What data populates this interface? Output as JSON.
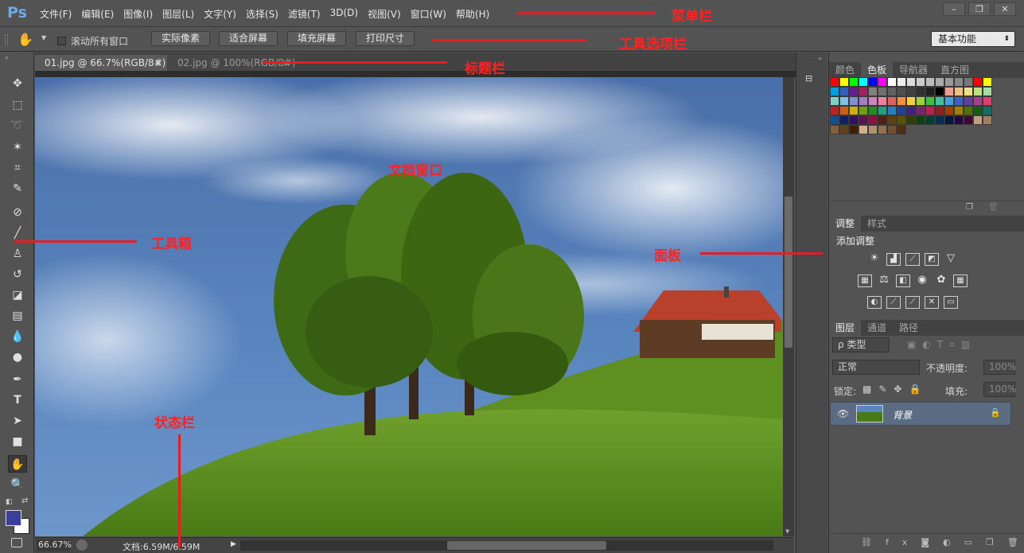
{
  "app": {
    "logo": "Ps"
  },
  "menu": [
    "文件(F)",
    "编辑(E)",
    "图像(I)",
    "图层(L)",
    "文字(Y)",
    "选择(S)",
    "滤镜(T)",
    "3D(D)",
    "视图(V)",
    "窗口(W)",
    "帮助(H)"
  ],
  "window_controls": [
    "–",
    "❐",
    "✕"
  ],
  "options": {
    "scroll_all_label": "滚动所有窗口",
    "buttons": [
      "实际像素",
      "适合屏幕",
      "填充屏幕",
      "打印尺寸"
    ],
    "workspace": "基本功能"
  },
  "tabs": [
    {
      "label": "01.jpg @ 66.7%(RGB/8#)",
      "close": "×"
    },
    {
      "label": "02.jpg @ 100%(RGB/8#)",
      "close": "×"
    }
  ],
  "status": {
    "zoom": "66.67%",
    "doc_info": "文档:6.59M/6.59M"
  },
  "panels": {
    "color_tabs": [
      "颜色",
      "色板",
      "导航器",
      "直方图"
    ],
    "adjust_tabs": [
      "调整",
      "样式"
    ],
    "adjust_title": "添加调整",
    "layer_tabs": [
      "图层",
      "通道",
      "路径"
    ],
    "kind_filter": "ρ 类型",
    "blend_mode": "正常",
    "opacity_label": "不透明度:",
    "opacity_value": "100%",
    "lock_label": "锁定:",
    "fill_label": "填充:",
    "fill_value": "100%",
    "layer_name": "背景"
  },
  "annotations": {
    "menu": "菜单栏",
    "options": "工具选项栏",
    "title": "标题栏",
    "document": "文档窗口",
    "toolbox": "工具箱",
    "panel": "面板",
    "status": "状态栏"
  },
  "colors": {
    "accent_red": "#e51d25",
    "app_bg": "#535353",
    "logo_blue": "#6ea9e4"
  }
}
